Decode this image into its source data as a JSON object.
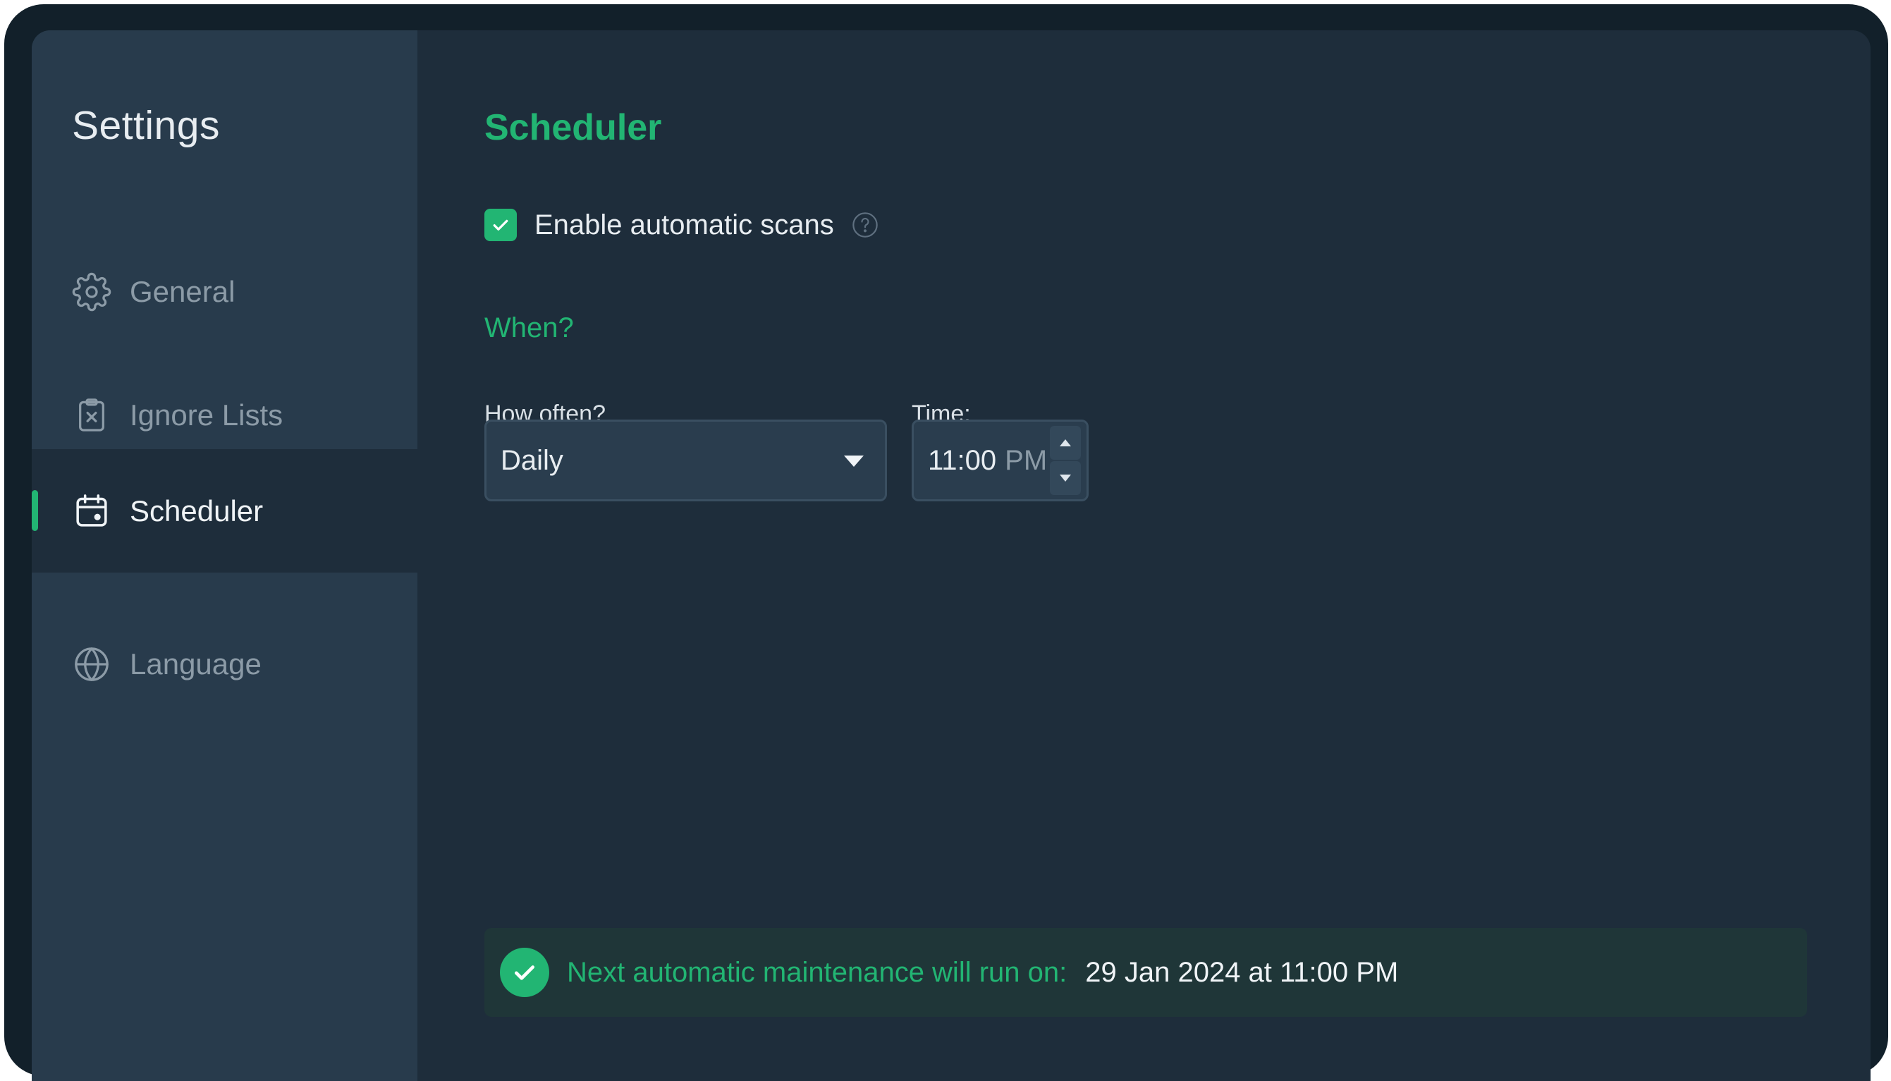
{
  "sidebar": {
    "title": "Settings",
    "items": [
      {
        "label": "General",
        "icon": "gear-icon"
      },
      {
        "label": "Ignore Lists",
        "icon": "clipboard-x-icon"
      },
      {
        "label": "Scheduler",
        "icon": "calendar-icon",
        "active": true
      },
      {
        "label": "Language",
        "icon": "globe-icon"
      }
    ]
  },
  "main": {
    "title": "Scheduler",
    "enable_scans": {
      "label": "Enable automatic scans",
      "checked": true
    },
    "when_heading": "When?",
    "frequency": {
      "label": "How often?",
      "value": "Daily"
    },
    "time": {
      "label": "Time:",
      "hm": "11:00",
      "ampm": "PM"
    },
    "status": {
      "text": "Next automatic maintenance will run on:",
      "date": "29 Jan 2024 at 11:00 PM"
    }
  },
  "colors": {
    "accent": "#22b573",
    "background": "#1e2d3b",
    "sidebar": "#283b4c"
  }
}
